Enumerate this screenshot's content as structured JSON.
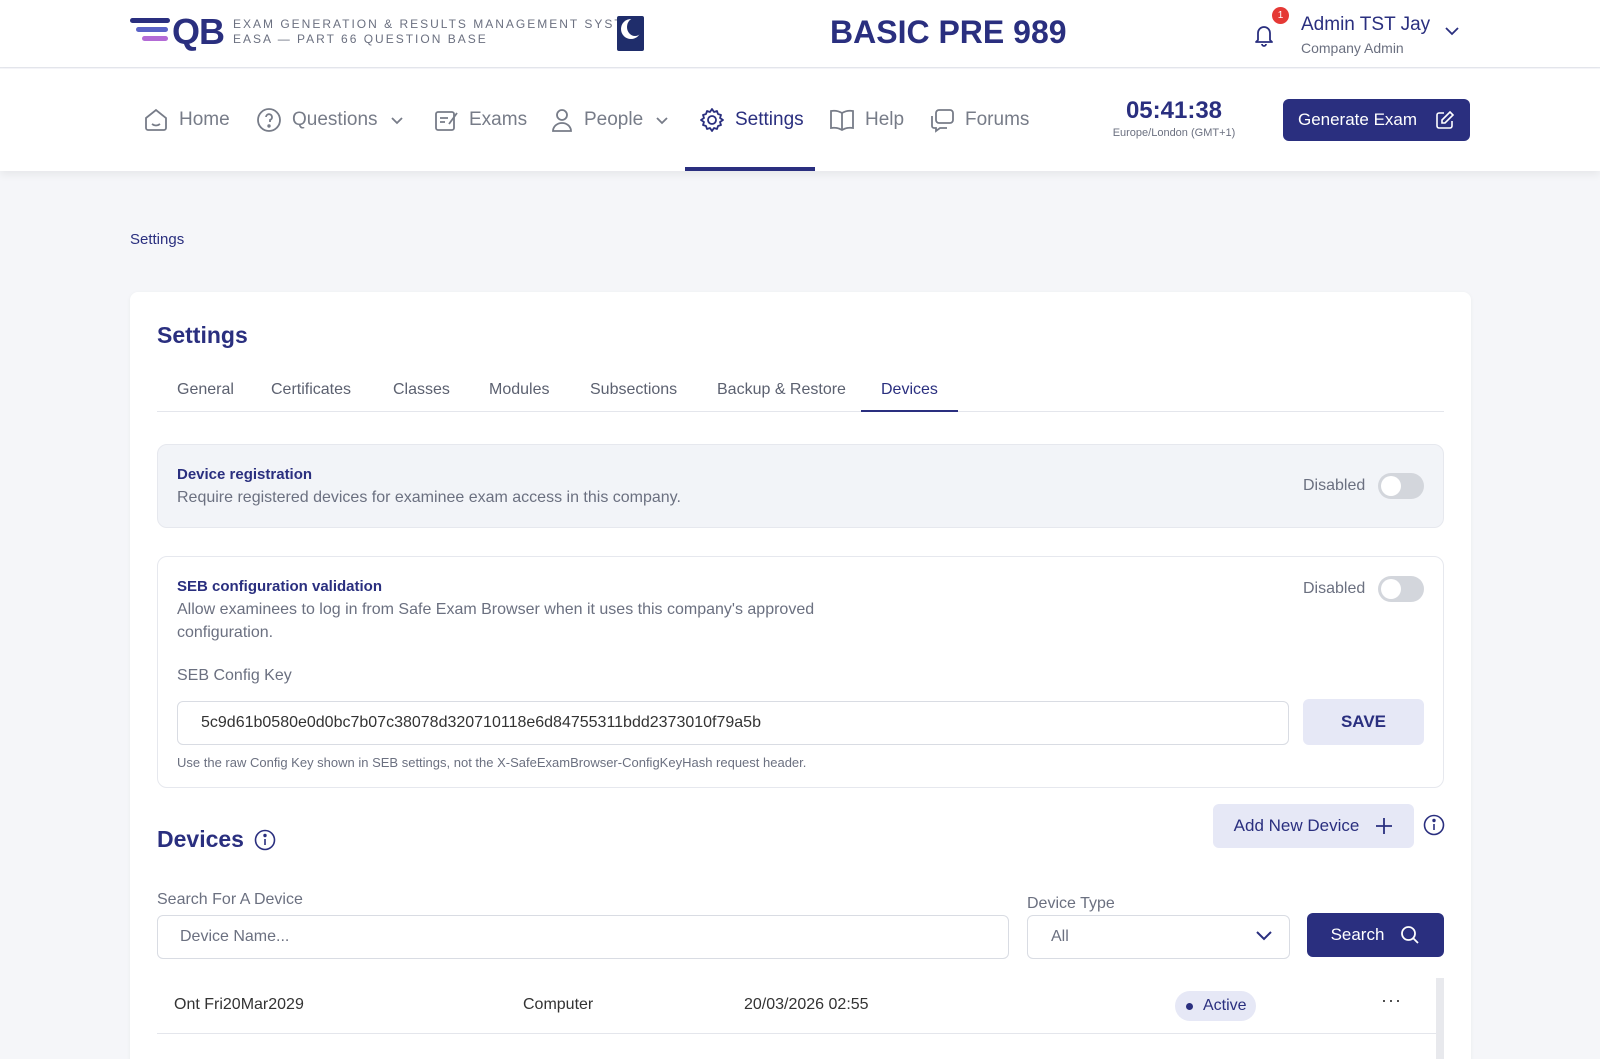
{
  "header": {
    "logo_text": "QB",
    "system_line1": "EXAM GENERATION & RESULTS MANAGEMENT SYSTEM",
    "system_line2": "EASA — PART 66 QUESTION BASE",
    "app_title": "BASIC PRE 989",
    "notification_count": "1",
    "user_name": "Admin TST Jay",
    "user_role": "Company Admin"
  },
  "nav": {
    "items": [
      {
        "label": "Home",
        "icon": "home-icon"
      },
      {
        "label": "Questions",
        "icon": "question-icon",
        "dropdown": true
      },
      {
        "label": "Exams",
        "icon": "exams-icon"
      },
      {
        "label": "People",
        "icon": "person-icon",
        "dropdown": true
      },
      {
        "label": "Settings",
        "icon": "gear-icon",
        "active": true
      },
      {
        "label": "Help",
        "icon": "book-icon"
      },
      {
        "label": "Forums",
        "icon": "chat-icon"
      }
    ],
    "clock_time": "05:41:38",
    "clock_timezone": "Europe/London (GMT+1)",
    "generate_button": "Generate Exam"
  },
  "breadcrumb": "Settings",
  "settings": {
    "title": "Settings",
    "tabs": [
      "General",
      "Certificates",
      "Classes",
      "Modules",
      "Subsections",
      "Backup & Restore",
      "Devices"
    ],
    "active_tab": "Devices",
    "device_registration": {
      "title": "Device registration",
      "description": "Require registered devices for examinee exam access in this company.",
      "status": "Disabled"
    },
    "seb_validation": {
      "title": "SEB configuration validation",
      "description_line1": "Allow examinees to log in from Safe Exam Browser when it uses this company's approved",
      "description_line2": "configuration.",
      "status": "Disabled",
      "key_label": "SEB Config Key",
      "key_value": "5c9d61b0580e0d0bc7b07c38078d320710118e6d84755311bdd2373010f79a5b",
      "save_button": "SAVE",
      "help_text": "Use the raw Config Key shown in SEB settings, not the X-SafeExamBrowser-ConfigKeyHash request header."
    }
  },
  "devices": {
    "title": "Devices",
    "add_button": "Add New Device",
    "search_label": "Search For A Device",
    "search_placeholder": "Device Name...",
    "type_label": "Device Type",
    "type_selected": "All",
    "search_button": "Search",
    "rows": [
      {
        "name": "Ont Fri20Mar2029",
        "type": "Computer",
        "date": "20/03/2026 02:55",
        "status": "Active",
        "actions": "···"
      }
    ]
  },
  "colors": {
    "primary": "#2a2f7f",
    "primary_light": "#e6e8f6",
    "badge_red": "#e53935",
    "background": "#f5f6f9"
  }
}
